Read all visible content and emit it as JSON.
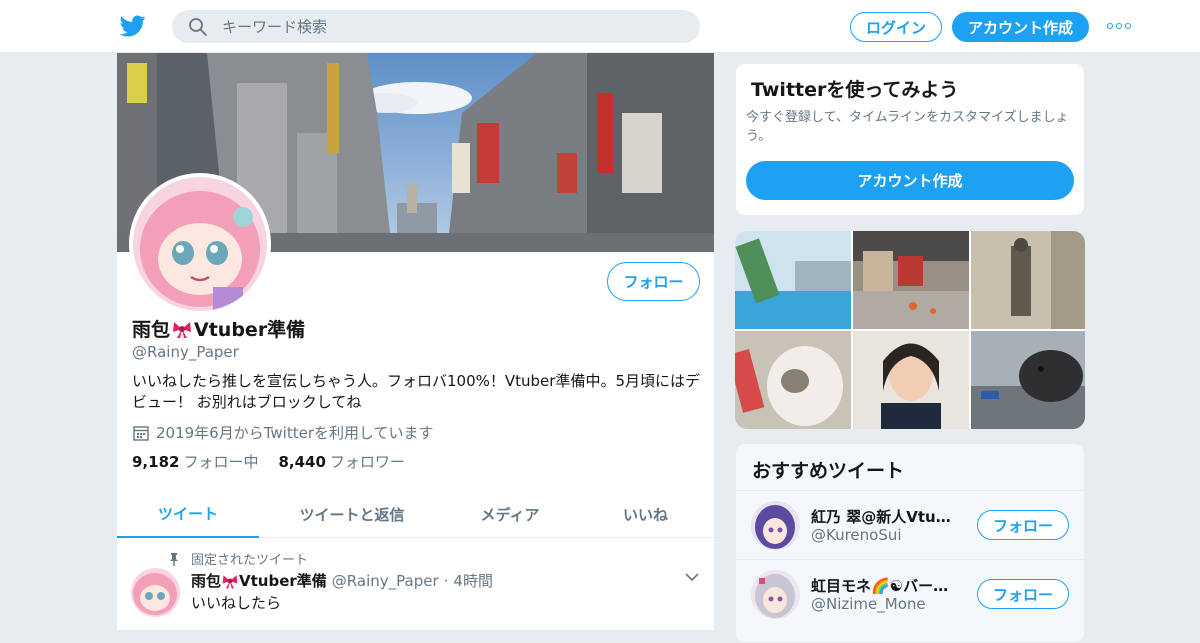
{
  "header": {
    "logo_icon": "twitter-bird-icon",
    "search_placeholder": "キーワード検索",
    "login_label": "ログイン",
    "signup_label": "アカウント作成",
    "more_icon": "more-dots-icon",
    "accent_color": "#1da1f2"
  },
  "profile": {
    "name_part1": "雨包",
    "name_part2": "Vtuber準備",
    "handle": "@Rainy_Paper",
    "bio": "いいねしたら推しを宣伝しちゃう人。フォロバ100%！Vtuber準備中。5月頃にはデビュー！ お別れはブロックしてね",
    "joined": "2019年6月からTwitterを利用しています",
    "following_count": "9,182",
    "following_label": "フォロー中",
    "followers_count": "8,440",
    "followers_label": "フォロワー",
    "follow_label": "フォロー"
  },
  "tabs": [
    "ツイート",
    "ツイートと返信",
    "メディア",
    "いいね"
  ],
  "pinned_tweet": {
    "pinned_label": "固定されたツイート",
    "name_part1": "雨包",
    "name_part2": "Vtuber準備",
    "handle": "@Rainy_Paper",
    "separator": "·",
    "time": "4時間",
    "text": "いいねしたら"
  },
  "signup_card": {
    "title": "Twitterを使ってみよう",
    "text": "今すぐ登録して、タイムラインをカスタマイズしましょう。",
    "cta": "アカウント作成"
  },
  "recommended": {
    "title": "おすすめツイート",
    "users": [
      {
        "name": "紅乃 翠@新人Vtuber",
        "handle": "@KurenoSui",
        "follow_label": "フォロー"
      },
      {
        "name": "虹目モネ🌈☯バーチャル",
        "handle": "@Nizime_Mone",
        "follow_label": "フォロー"
      }
    ]
  }
}
